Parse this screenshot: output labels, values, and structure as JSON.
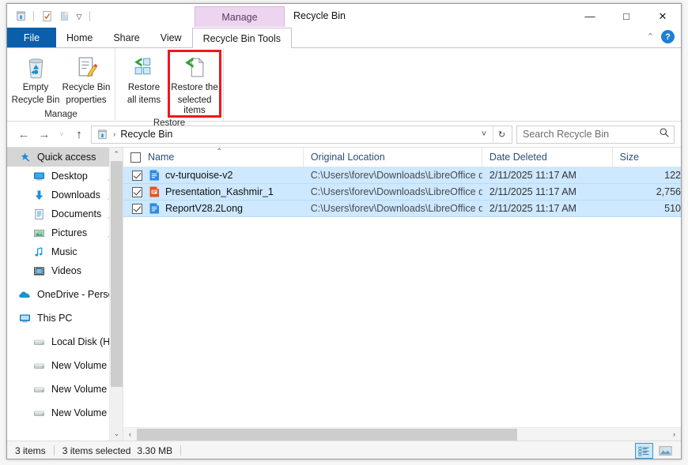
{
  "window": {
    "title": "Recycle Bin",
    "contextual_tab_header": "Manage",
    "minimize": "—",
    "maximize": "□",
    "close": "✕",
    "help": "?",
    "collapse_ribbon": "⌃"
  },
  "quick_access_toolbar": {
    "items": [
      {
        "name": "recycle-bin-icon",
        "label": "Recycle Bin"
      },
      {
        "name": "properties-icon",
        "label": "Properties"
      },
      {
        "name": "paste-icon",
        "label": "Paste"
      }
    ],
    "customize_caret": "≡"
  },
  "tabs": [
    {
      "id": "file",
      "label": "File",
      "active": false
    },
    {
      "id": "home",
      "label": "Home",
      "active": false
    },
    {
      "id": "share",
      "label": "Share",
      "active": false
    },
    {
      "id": "view",
      "label": "View",
      "active": false
    },
    {
      "id": "recycle-bin-tools",
      "label": "Recycle Bin Tools",
      "active": true
    }
  ],
  "ribbon": {
    "groups": [
      {
        "id": "manage",
        "label": "Manage",
        "buttons": [
          {
            "id": "empty-recycle-bin",
            "line1": "Empty",
            "line2": "Recycle Bin",
            "icon": "trash-icon",
            "highlighted": false
          },
          {
            "id": "recycle-bin-properties",
            "line1": "Recycle Bin",
            "line2": "properties",
            "icon": "properties-pencil-icon",
            "highlighted": false
          }
        ]
      },
      {
        "id": "restore",
        "label": "Restore",
        "buttons": [
          {
            "id": "restore-all-items",
            "line1": "Restore",
            "line2": "all items",
            "icon": "restore-all-icon",
            "highlighted": false
          },
          {
            "id": "restore-selected-items",
            "line1": "Restore the",
            "line2": "selected items",
            "icon": "restore-selected-icon",
            "highlighted": true
          }
        ]
      }
    ],
    "highlight_color": "#f0161d"
  },
  "address_bar": {
    "back": "←",
    "forward": "→",
    "recent": "˅",
    "up": "↑",
    "breadcrumb_icon": "recycle-bin-icon",
    "breadcrumb_separator": "›",
    "breadcrumb_text": "Recycle Bin",
    "dropdown": "˅",
    "refresh": "↻"
  },
  "search": {
    "placeholder": "Search Recycle Bin",
    "value": "",
    "icon": "search-icon"
  },
  "nav_pane": {
    "items": [
      {
        "id": "quick-access",
        "label": "Quick access",
        "icon": "star-pin-icon",
        "selected": true,
        "child": false,
        "pinned": false
      },
      {
        "id": "desktop",
        "label": "Desktop",
        "icon": "desktop-icon",
        "selected": false,
        "child": true,
        "pinned": true
      },
      {
        "id": "downloads",
        "label": "Downloads",
        "icon": "downloads-icon",
        "selected": false,
        "child": true,
        "pinned": true
      },
      {
        "id": "documents",
        "label": "Documents",
        "icon": "documents-icon",
        "selected": false,
        "child": true,
        "pinned": true
      },
      {
        "id": "pictures",
        "label": "Pictures",
        "icon": "pictures-icon",
        "selected": false,
        "child": true,
        "pinned": true
      },
      {
        "id": "music",
        "label": "Music",
        "icon": "music-icon",
        "selected": false,
        "child": true,
        "pinned": false
      },
      {
        "id": "videos",
        "label": "Videos",
        "icon": "videos-icon",
        "selected": false,
        "child": true,
        "pinned": false
      },
      {
        "id": "onedrive-personal",
        "label": "OneDrive - Person",
        "icon": "cloud-icon",
        "selected": false,
        "child": false,
        "pinned": false
      },
      {
        "id": "this-pc",
        "label": "This PC",
        "icon": "this-pc-icon",
        "selected": false,
        "child": false,
        "pinned": false
      },
      {
        "id": "local-disk-h",
        "label": "Local Disk (H:)",
        "icon": "drive-icon",
        "selected": false,
        "child": true,
        "pinned": false
      },
      {
        "id": "new-volume-e",
        "label": "New Volume (E:)",
        "icon": "drive-icon",
        "selected": false,
        "child": true,
        "pinned": false
      },
      {
        "id": "new-volume-f",
        "label": "New Volume (F:)",
        "icon": "drive-icon",
        "selected": false,
        "child": true,
        "pinned": false
      },
      {
        "id": "new-volume-g",
        "label": "New Volume (G:)",
        "icon": "drive-icon",
        "selected": false,
        "child": true,
        "pinned": false
      }
    ],
    "scroll_up": "⌃",
    "scroll_down": "⌄"
  },
  "file_list": {
    "columns": [
      {
        "id": "name",
        "label": "Name",
        "sorted": "asc"
      },
      {
        "id": "original_location",
        "label": "Original Location",
        "sorted": ""
      },
      {
        "id": "date_deleted",
        "label": "Date Deleted",
        "sorted": ""
      },
      {
        "id": "size",
        "label": "Size",
        "sorted": ""
      }
    ],
    "sort_caret": "⌃",
    "rows": [
      {
        "name": "cv-turquoise-v2",
        "original_location": "C:\\Users\\forev\\Downloads\\LibreOffice d...",
        "date_deleted": "2/11/2025 11:17 AM",
        "size": "122",
        "icon": "writer-document-icon",
        "checked": true,
        "selected": true
      },
      {
        "name": "Presentation_Kashmir_1",
        "original_location": "C:\\Users\\forev\\Downloads\\LibreOffice d...",
        "date_deleted": "2/11/2025 11:17 AM",
        "size": "2,756",
        "icon": "impress-presentation-icon",
        "checked": true,
        "selected": true
      },
      {
        "name": "ReportV28.2Long",
        "original_location": "C:\\Users\\forev\\Downloads\\LibreOffice d...",
        "date_deleted": "2/11/2025 11:17 AM",
        "size": "510",
        "icon": "writer-document-icon",
        "checked": true,
        "selected": true
      }
    ],
    "h_scroll_left": "‹",
    "h_scroll_right": "›"
  },
  "status_bar": {
    "item_count": "3 items",
    "selected_count": "3 items selected",
    "selected_size": "3.30 MB",
    "views": [
      {
        "id": "details-view",
        "label": "Details view",
        "active": true
      },
      {
        "id": "large-icons-view",
        "label": "Large icons view",
        "active": false
      }
    ]
  },
  "colors": {
    "file_tab": "#0a5fad",
    "contextual_purple": "#edd5ef",
    "selection_blue": "#cde8ff",
    "header_text": "#2a4f77",
    "highlight_red": "#f0161d"
  }
}
